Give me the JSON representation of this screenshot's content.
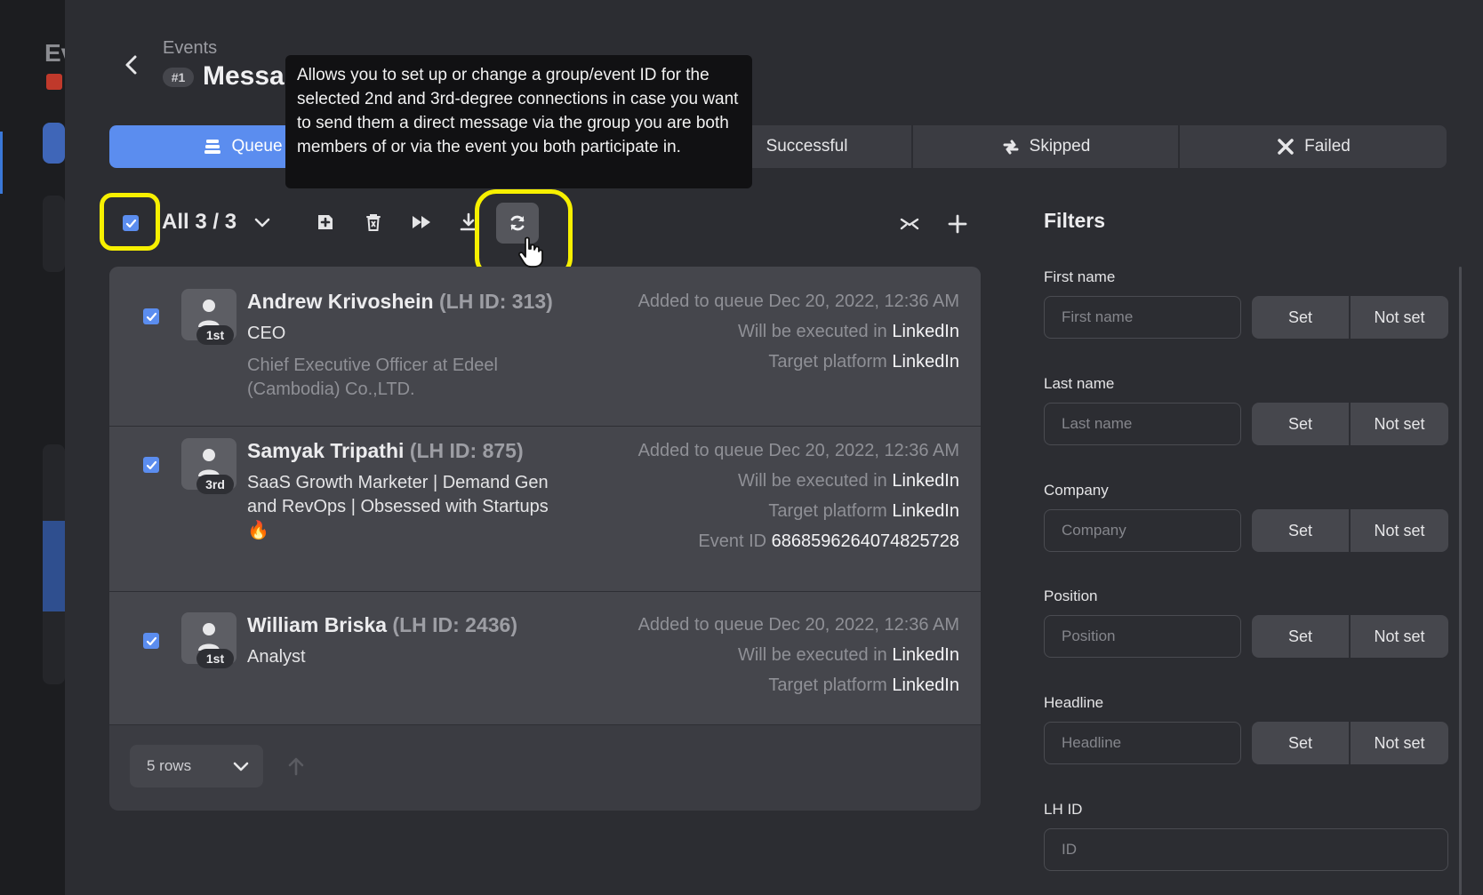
{
  "background_app": {
    "title_fragment": "Ev"
  },
  "header": {
    "breadcrumb": "Events",
    "campaign_number": "#1",
    "title": "Messages"
  },
  "tabs": [
    {
      "label": "Queue"
    },
    {
      "label": "Successful"
    },
    {
      "label": "Skipped"
    },
    {
      "label": "Failed"
    }
  ],
  "tooltip": {
    "text": "Allows you to set up or change a group/event ID for the selected 2nd and 3rd-degree connections in case you want to send them a direct message via the group you are both members of or via the event you both participate in."
  },
  "toolbar": {
    "select_label": "All 3 / 3",
    "icons": [
      "add-icon",
      "trash-icon",
      "fast-forward-icon",
      "download-icon",
      "refresh-icon",
      "collapse-icon",
      "plus-icon"
    ]
  },
  "queue": [
    {
      "name": "Andrew Krivoshein",
      "lh_id": "(LH ID: 313)",
      "degree": "1st",
      "headline": "CEO",
      "subline": "Chief Executive Officer at Edeel (Cambodia) Co.,LTD.",
      "added_label": "Added to queue",
      "added_value": "Dec 20, 2022, 12:36 AM",
      "executed_label": "Will be executed in",
      "executed_value": "LinkedIn",
      "platform_label": "Target platform",
      "platform_value": "LinkedIn"
    },
    {
      "name": "Samyak Tripathi",
      "lh_id": "(LH ID: 875)",
      "degree": "3rd",
      "headline": "SaaS Growth Marketer | Demand Gen and RevOps | Obsessed with Startups 🔥",
      "added_label": "Added to queue",
      "added_value": "Dec 20, 2022, 12:36 AM",
      "executed_label": "Will be executed in",
      "executed_value": "LinkedIn",
      "platform_label": "Target platform",
      "platform_value": "LinkedIn",
      "event_label": "Event ID",
      "event_value": "6868596264074825728"
    },
    {
      "name": "William Briska",
      "lh_id": "(LH ID: 2436)",
      "degree": "1st",
      "headline": "Analyst",
      "added_label": "Added to queue",
      "added_value": "Dec 20, 2022, 12:36 AM",
      "executed_label": "Will be executed in",
      "executed_value": "LinkedIn",
      "platform_label": "Target platform",
      "platform_value": "LinkedIn"
    }
  ],
  "pagination": {
    "rows_label": "5 rows"
  },
  "filters": {
    "title": "Filters",
    "set_label": "Set",
    "not_set_label": "Not set",
    "fields": [
      {
        "label": "First name",
        "placeholder": "First name"
      },
      {
        "label": "Last name",
        "placeholder": "Last name"
      },
      {
        "label": "Company",
        "placeholder": "Company"
      },
      {
        "label": "Position",
        "placeholder": "Position"
      },
      {
        "label": "Headline",
        "placeholder": "Headline"
      },
      {
        "label": "LH ID",
        "placeholder": "ID"
      }
    ]
  },
  "colors": {
    "accent": "#5b8def",
    "highlight": "#f7f000",
    "panel": "#45464c",
    "tooltip_bg": "#111113"
  }
}
